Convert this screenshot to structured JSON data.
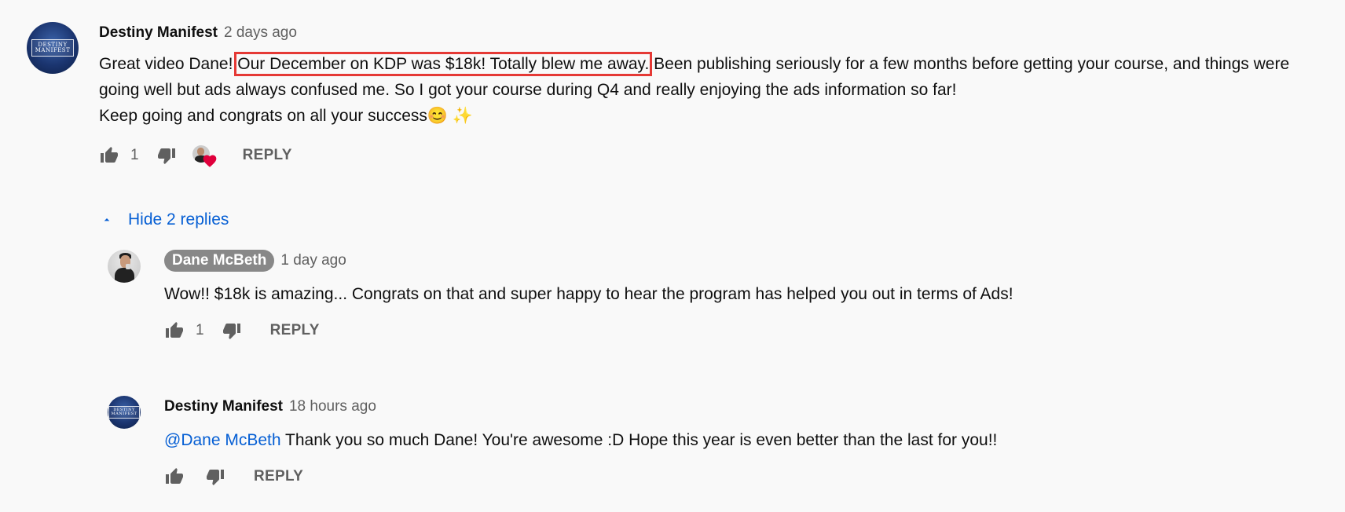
{
  "colors": {
    "background": "#f9f9f9",
    "link": "#065fd4",
    "highlight_border": "#e53935",
    "heart": "#e0003c",
    "author_chip": "#888888",
    "meta": "#606060"
  },
  "top_comment": {
    "author": "Destiny Manifest",
    "time": "2 days ago",
    "avatar_text_line1": "DESTINY",
    "avatar_text_line2": "MANIFEST",
    "text_before": "Great video Dane! ",
    "text_highlight": "Our December on KDP was $18k! Totally blew me away.",
    "text_after": " Been publishing seriously for a few months before getting your course, and things were going well but ads always confused me. So I got your course during Q4 and really enjoying the ads information so far!",
    "text_line2": "Keep going and congrats on all your success😊 ✨",
    "likes": "1",
    "creator_heart": true,
    "reply_label": "REPLY",
    "icons": [
      "thumbs-up-icon",
      "thumbs-down-icon",
      "creator-heart-icon"
    ]
  },
  "replies_toggle": {
    "label": "Hide 2 replies",
    "icon": "caret-up-icon"
  },
  "replies": [
    {
      "author": "Dane McBeth",
      "author_is_creator": true,
      "time": "1 day ago",
      "mention": "",
      "text": "Wow!! $18k is amazing... Congrats on that and super happy to hear the program has helped you out in terms of Ads!",
      "likes": "1",
      "reply_label": "REPLY"
    },
    {
      "author": "Destiny Manifest",
      "author_is_creator": false,
      "time": "18 hours ago",
      "mention": "@Dane McBeth",
      "text": " Thank you so much Dane! You're awesome :D Hope this year is even better than the last for you!!",
      "likes": "",
      "reply_label": "REPLY"
    }
  ]
}
